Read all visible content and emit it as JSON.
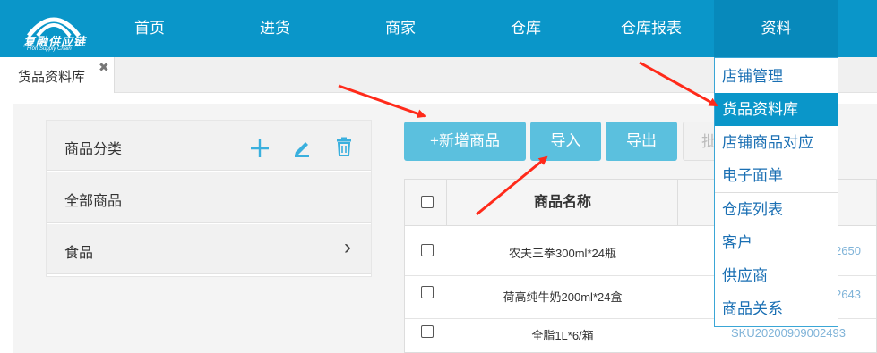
{
  "logo": {
    "name": "复融供应链",
    "sub": "Fron Supply Chain"
  },
  "nav": {
    "items": [
      "首页",
      "进货",
      "商家",
      "仓库",
      "仓库报表",
      "资料"
    ],
    "active_index": 5
  },
  "tabs": [
    {
      "label": "货品资料库",
      "close": "✖"
    }
  ],
  "sidebar": {
    "header": "商品分类",
    "rows": [
      {
        "label": "全部商品"
      },
      {
        "label": "食品",
        "chevron": "›"
      }
    ]
  },
  "toolbar": {
    "add": "+新增商品",
    "import": "导入",
    "export": "导出",
    "partial": "批"
  },
  "table": {
    "headers": [
      "商品名称"
    ],
    "rows": [
      {
        "name": "农夫三拳300ml*24瓶",
        "sku": "2650"
      },
      {
        "name": "荷高纯牛奶200ml*24盒",
        "sku": "2643"
      },
      {
        "name": "全脂1L*6/箱",
        "sku": "SKU20200909002493"
      }
    ]
  },
  "dropdown": {
    "items": [
      "店铺管理",
      "货品资料库",
      "店铺商品对应",
      "电子面单",
      "仓库列表",
      "客户",
      "供应商",
      "商品关系"
    ],
    "active_index": 1
  },
  "colors": {
    "brand": "#0a96c9",
    "button": "#5bc0de",
    "arrow": "#ff2a1a",
    "icon": "#3ab0de"
  }
}
